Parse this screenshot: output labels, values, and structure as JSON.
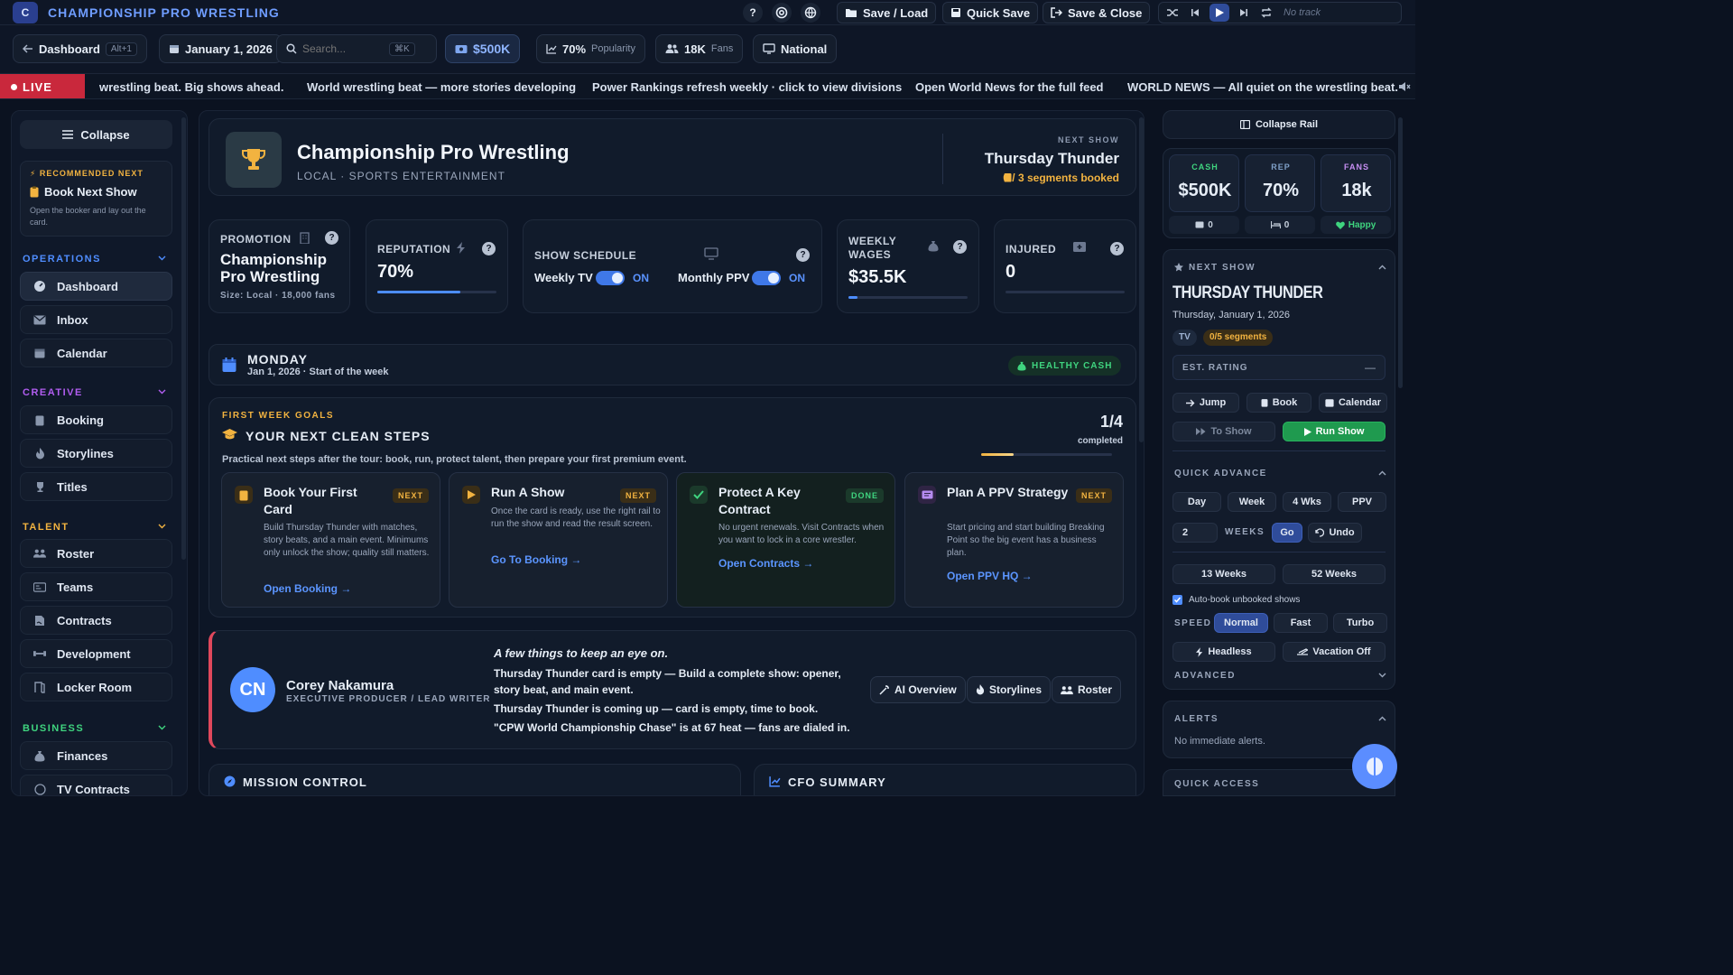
{
  "app": {
    "logo_letter": "C",
    "brand": "CHAMPIONSHIP PRO WRESTLING"
  },
  "toolbar": {
    "help": "?",
    "save_load": "Save / Load",
    "quick_save": "Quick Save",
    "save_close": "Save & Close",
    "no_track": "No track"
  },
  "subbar": {
    "dashboard": "Dashboard",
    "dashboard_kbd": "Alt+1",
    "date": "January 1, 2026",
    "search_placeholder": "Search...",
    "search_kbd": "⌘K",
    "cash": "$500K",
    "popularity_value": "70%",
    "popularity_label": "Popularity",
    "fans_value": "18K",
    "fans_label": "Fans",
    "region": "National"
  },
  "ticker": {
    "live": "LIVE",
    "items": [
      "wrestling beat. Big shows ahead.",
      "World wrestling beat — more stories developing",
      "Power Rankings refresh weekly · click to view divisions",
      "Open World News for the full feed",
      "WORLD NEWS — All quiet on the wrestling beat. Big"
    ]
  },
  "sidebar": {
    "collapse": "Collapse",
    "recommended_kicker": "⚡ RECOMMENDED NEXT",
    "recommended_title": "Book Next Show",
    "recommended_desc": "Open the booker and lay out the card.",
    "sections": [
      {
        "title": "OPERATIONS",
        "color": "#4f8dff",
        "items": [
          "Dashboard",
          "Inbox",
          "Calendar"
        ]
      },
      {
        "title": "CREATIVE",
        "color": "#b15df0",
        "items": [
          "Booking",
          "Storylines",
          "Titles"
        ]
      },
      {
        "title": "TALENT",
        "color": "#f2b340",
        "items": [
          "Roster",
          "Teams",
          "Contracts",
          "Development",
          "Locker Room"
        ]
      },
      {
        "title": "BUSINESS",
        "color": "#3fd47f",
        "items": [
          "Finances",
          "TV Contracts"
        ]
      }
    ]
  },
  "hero": {
    "title": "Championship Pro Wrestling",
    "subtitle": "LOCAL · SPORTS ENTERTAINMENT",
    "next_kicker": "NEXT SHOW",
    "next_title": "Thursday Thunder",
    "next_status": "0 / 3 segments booked"
  },
  "stats": {
    "promotion_label": "PROMOTION",
    "promotion_name_1": "Championship",
    "promotion_name_2": "Pro Wrestling",
    "promotion_size": "Size: Local · 18,000 fans",
    "reputation_label": "REPUTATION",
    "reputation_value": "70%",
    "reputation_pct": 70,
    "schedule_label": "SHOW SCHEDULE",
    "weekly_tv": "Weekly TV",
    "monthly_ppv": "Monthly PPV",
    "on": "ON",
    "wages_label_1": "WEEKLY",
    "wages_label_2": "WAGES",
    "wages_value": "$35.5K",
    "injured_label": "INJURED",
    "injured_value": "0"
  },
  "day": {
    "title": "MONDAY",
    "subtitle": "Jan 1, 2026 · Start of the week",
    "badge": "HEALTHY CASH"
  },
  "goals": {
    "kicker": "FIRST WEEK GOALS",
    "title": "YOUR NEXT CLEAN STEPS",
    "desc": "Practical next steps after the tour: book, run, protect talent, then prepare your first premium event.",
    "count": "1/4",
    "count_label": "completed",
    "progress_pct": 25,
    "items": [
      {
        "title": "Book Your First Card",
        "badge": "NEXT",
        "desc": "Build Thursday Thunder with matches, story beats, and a main event. Minimums only unlock the show; quality still matters.",
        "link": "Open Booking →"
      },
      {
        "title": "Run A Show",
        "badge": "NEXT",
        "desc": "Once the card is ready, use the right rail to run the show and read the result screen.",
        "link": "Go To Booking →"
      },
      {
        "title": "Protect A Key Contract",
        "badge": "DONE",
        "desc": "No urgent renewals. Visit Contracts when you want to lock in a core wrestler.",
        "link": "Open Contracts →"
      },
      {
        "title": "Plan A PPV Strategy",
        "badge": "NEXT",
        "desc": "Start pricing and start building Breaking Point so the big event has a business plan.",
        "link": "Open PPV HQ →"
      }
    ]
  },
  "advisor": {
    "initials": "CN",
    "name": "Corey Nakamura",
    "role": "EXECUTIVE PRODUCER / LEAD WRITER",
    "headline": "A few things to keep an eye on.",
    "line1": "Thursday Thunder card is empty — Build a complete show: opener,",
    "line1b": "story beat, and main event.",
    "line2": "Thursday Thunder is coming up — card is empty, time to book.",
    "line3": "\"CPW World Championship Chase\" is at 67 heat — fans are dialed in.",
    "btn_ai": "AI Overview",
    "btn_story": "Storylines",
    "btn_roster": "Roster"
  },
  "bottom": {
    "mission": "MISSION CONTROL",
    "cfo": "CFO SUMMARY"
  },
  "rail": {
    "collapse": "Collapse Rail",
    "cash_k": "CASH",
    "cash_v": "$500K",
    "rep_k": "REP",
    "rep_v": "70%",
    "fans_k": "FANS",
    "fans_v": "18k",
    "mini1": "0",
    "mini2": "0",
    "mini3": "Happy",
    "next_k": "NEXT SHOW",
    "next_title": "THURSDAY THUNDER",
    "next_date": "Thursday, January 1, 2026",
    "tag_tv": "TV",
    "tag_seg": "0/5 segments",
    "est_rating": "EST. RATING",
    "est_value": "—",
    "jump": "Jump",
    "book": "Book",
    "calendar": "Calendar",
    "to_show": "To Show",
    "run_show": "Run Show",
    "qa_k": "QUICK ADVANCE",
    "day": "Day",
    "week": "Week",
    "four_wks": "4 Wks",
    "ppv": "PPV",
    "weeks_value": "2",
    "weeks_label": "WEEKS",
    "go": "Go",
    "undo": "Undo",
    "w13": "13 Weeks",
    "w52": "52 Weeks",
    "autobook": "Auto-book unbooked shows",
    "speed_k": "SPEED",
    "normal": "Normal",
    "fast": "Fast",
    "turbo": "Turbo",
    "headless": "Headless",
    "vacation": "Vacation Off",
    "advanced": "ADVANCED",
    "alerts_k": "ALERTS",
    "alerts_v": "No immediate alerts.",
    "quick_access": "QUICK ACCESS"
  }
}
